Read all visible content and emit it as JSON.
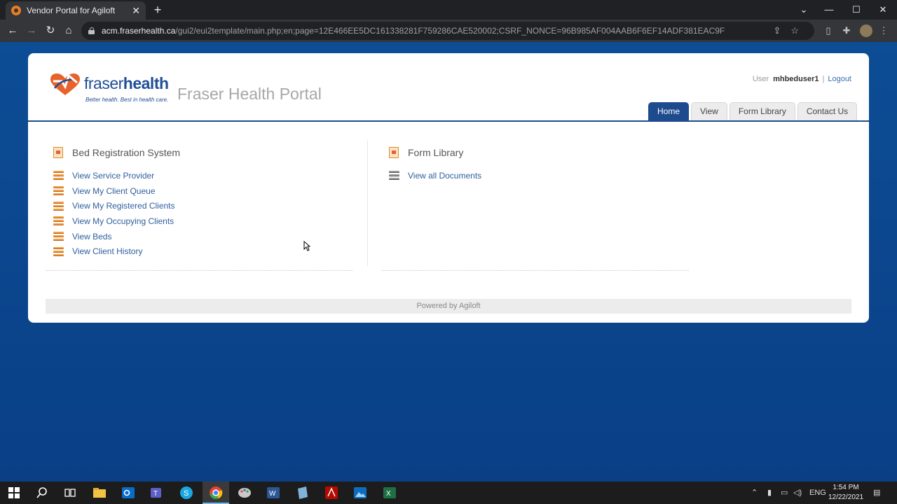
{
  "browser": {
    "tab_title": "Vendor Portal for Agiloft",
    "url_host": "acm.fraserhealth.ca",
    "url_path": "/gui2/eui2template/main.php;en;page=12E466EE5DC161338281F759286CAE520002;CSRF_NONCE=96B985AF004AAB6F6EF14ADF381EAC9F"
  },
  "header": {
    "logo_wordmark_light": "fraser",
    "logo_wordmark_bold": "health",
    "logo_tagline": "Better health. Best in health care.",
    "portal_title": "Fraser Health Portal",
    "user_label": "User",
    "username": "mhbeduser1",
    "separator": "|",
    "logout_label": "Logout"
  },
  "nav_tabs": [
    {
      "label": "Home",
      "active": true
    },
    {
      "label": "View",
      "active": false
    },
    {
      "label": "Form Library",
      "active": false
    },
    {
      "label": "Contact Us",
      "active": false
    }
  ],
  "sections": [
    {
      "title": "Bed Registration System",
      "links": [
        "View Service Provider",
        "View My Client Queue",
        "View My Registered Clients",
        "View My Occupying Clients",
        "View Beds",
        "View Client History"
      ]
    },
    {
      "title": "Form Library",
      "links": [
        "View all Documents"
      ]
    }
  ],
  "footer": {
    "text": "Powered by Agiloft"
  },
  "taskbar": {
    "apps": [
      "windows-start",
      "search",
      "task-view",
      "file-explorer",
      "outlook",
      "teams",
      "skype",
      "chrome",
      "paint",
      "word",
      "notepad",
      "acrobat",
      "photos",
      "excel"
    ],
    "language": "ENG",
    "time": "1:54 PM",
    "date": "12/22/2021"
  },
  "colors": {
    "accent": "#1e4a8e",
    "link": "#2e5f9e",
    "page_background": "#0b4a8f"
  }
}
